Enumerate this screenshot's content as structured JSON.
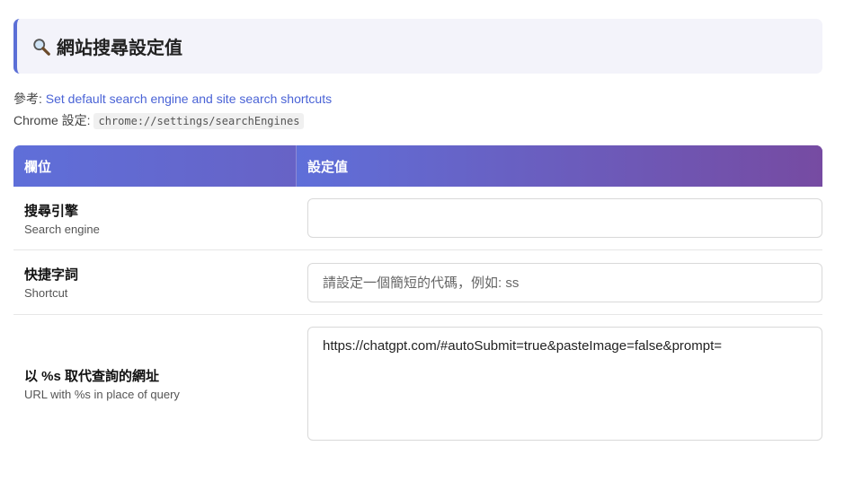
{
  "section": {
    "icon": "magnifier-icon",
    "title": "網站搜尋設定值"
  },
  "reference": {
    "prefix": "參考: ",
    "link_text": "Set default search engine and site search shortcuts"
  },
  "chrome_setting": {
    "prefix": "Chrome 設定: ",
    "path": "chrome://settings/searchEngines"
  },
  "table": {
    "headers": [
      "欄位",
      "設定值"
    ],
    "rows": [
      {
        "label_zh": "搜尋引擎",
        "label_en": "Search engine",
        "value": "",
        "placeholder": ""
      },
      {
        "label_zh": "快捷字詞",
        "label_en": "Shortcut",
        "value": "",
        "placeholder": "請設定一個簡短的代碼，例如: ss"
      },
      {
        "label_zh": "以 %s 取代查詢的網址",
        "label_en": "URL with %s in place of query",
        "value": "https://chatgpt.com/#autoSubmit=true&pasteImage=false&prompt=",
        "placeholder": ""
      }
    ]
  },
  "colors": {
    "accent": "#5b6fd6",
    "header_gradient_start": "#5f6fd9",
    "header_gradient_end": "#764ba2",
    "link": "#4a63d6"
  }
}
